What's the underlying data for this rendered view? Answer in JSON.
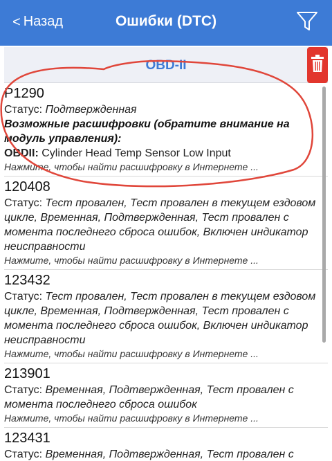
{
  "navbar": {
    "back_label": "Назад",
    "back_chevron": "<",
    "title": "Ошибки (DTC)",
    "filter_icon": "filter-icon",
    "bg_color": "#3d7bd6"
  },
  "section": {
    "title": "OBD-II",
    "trash_icon": "trash-icon",
    "trash_color": "#e2362d"
  },
  "status_label": "Статус:",
  "dtc_items": [
    {
      "code": "P1290",
      "status": "Подтвержденная",
      "possible_title": "Возможные расшифровки (обратите внимание на модуль управления):",
      "obd_label": "OBDII:",
      "obd_text": "Cylinder Head Temp Sensor Low Input",
      "hint": "Нажмите, чтобы найти расшифровку в Интернете ..."
    },
    {
      "code": "120408",
      "status": "Тест провален, Тест провален в текущем ездовом цикле, Временная, Подтвержденная, Тест провален с момента последнего сброса ошибок, Включен индикатор неисправности",
      "hint": "Нажмите, чтобы найти расшифровку в Интернете ..."
    },
    {
      "code": "123432",
      "status": "Тест провален, Тест провален в текущем ездовом цикле, Временная, Подтвержденная, Тест провален с момента последнего сброса ошибок, Включен индикатор неисправности",
      "hint": "Нажмите, чтобы найти расшифровку в Интернете ..."
    },
    {
      "code": "213901",
      "status": "Временная, Подтвержденная, Тест провален с момента последнего сброса ошибок",
      "hint": "Нажмите, чтобы найти расшифровку в Интернете ..."
    },
    {
      "code": "123431",
      "status": "Временная, Подтвержденная, Тест провален с момента последнего сброса ошибок, Тест не",
      "hint": ""
    }
  ],
  "annotation_color": "#e0463a"
}
